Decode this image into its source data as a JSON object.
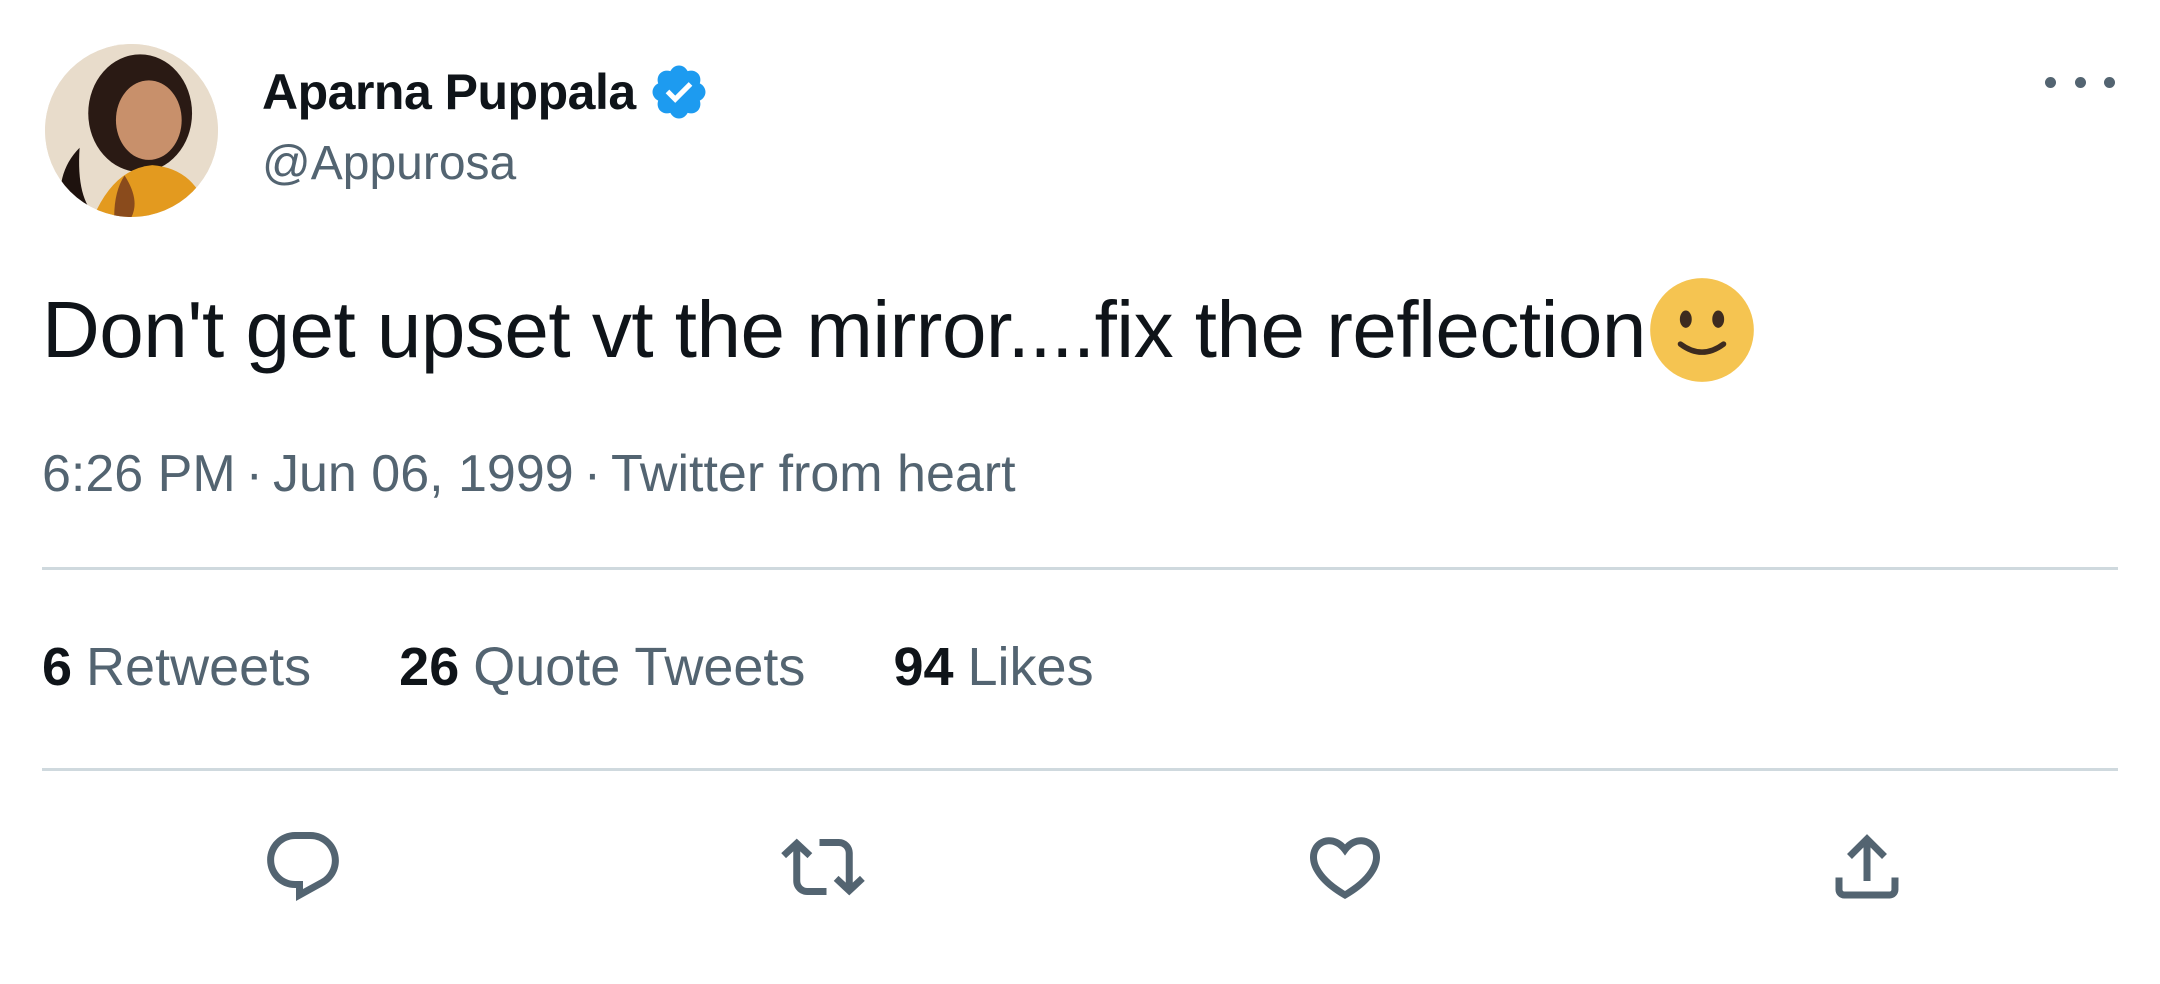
{
  "author": {
    "display_name": "Aparna Puppala",
    "handle": "@Appurosa",
    "verified": true
  },
  "tweet": {
    "text": "Don't get upset vt the mirror....fix the reflection",
    "emoji": "slightly-smiling-face"
  },
  "meta": {
    "time": "6:26 PM",
    "separator": "·",
    "date": "Jun 06, 1999",
    "source": "Twitter from heart"
  },
  "stats": {
    "retweets_count": "6",
    "retweets_label": "Retweets",
    "quote_count": "26",
    "quote_label": "Quote Tweets",
    "likes_count": "94",
    "likes_label": "Likes"
  },
  "colors": {
    "text_primary": "#0f1419",
    "text_secondary": "#536471",
    "divider": "#cfd9de",
    "verified_blue": "#1d9bf0",
    "emoji_yellow": "#f5c451"
  },
  "icons": {
    "more": "more-horizontal-icon",
    "verified": "verified-badge-icon",
    "reply": "reply-icon",
    "retweet": "retweet-icon",
    "like": "heart-icon",
    "share": "share-icon"
  }
}
